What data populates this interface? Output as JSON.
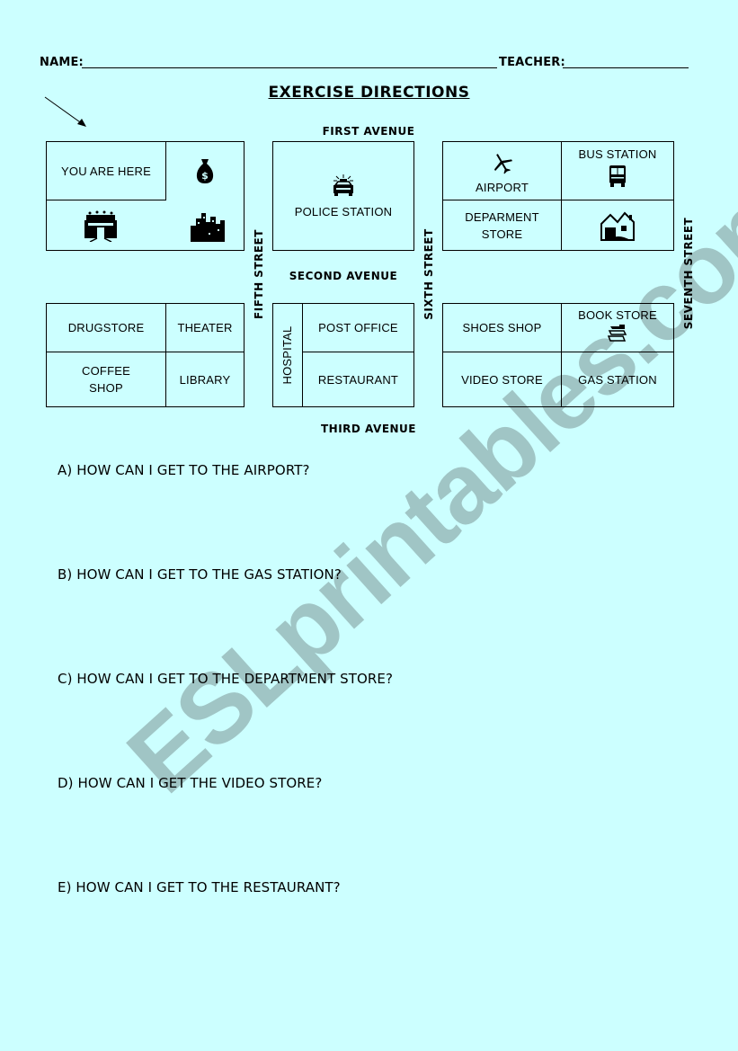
{
  "header": {
    "name_label": "NAME:",
    "teacher_label": "TEACHER:",
    "name_value": "",
    "teacher_value": ""
  },
  "title": "EXERCISE DIRECTIONS",
  "map": {
    "avenues": {
      "first": "FIRST AVENUE",
      "second": "SECOND AVENUE",
      "third": "THIRD AVENUE"
    },
    "streets": {
      "fifth": "FIFTH STREET",
      "sixth": "SIXTH STREET",
      "seventh": "SEVENTH STREET"
    },
    "start_marker": "you-are-here-arrow",
    "blocks": {
      "top_left": {
        "you_are_here": "YOU ARE HERE",
        "icons": [
          "money-bag-icon",
          "stadium-icon",
          "city-skyline-icon"
        ]
      },
      "top_middle": {
        "police_station": "POLICE STATION",
        "icon": "police-car-icon"
      },
      "top_right": {
        "airport": "AIRPORT",
        "bus_station": "BUS STATION",
        "department_store_line1": "DEPARMENT",
        "department_store_line2": "STORE",
        "icons": [
          "airplane-icon",
          "bus-icon",
          "houses-icon"
        ]
      },
      "bottom_left": {
        "drugstore": "DRUGSTORE",
        "theater": "THEATER",
        "coffee_shop_line1": "COFFEE",
        "coffee_shop_line2": "SHOP",
        "library": "LIBRARY"
      },
      "bottom_middle": {
        "hospital": "HOSPITAL",
        "post_office": "POST OFFICE",
        "restaurant": "RESTAURANT"
      },
      "bottom_right": {
        "shoes_shop": "SHOES SHOP",
        "book_store": "BOOK STORE",
        "video_store": "VIDEO STORE",
        "gas_station": "GAS STATION",
        "icon": "books-icon"
      }
    }
  },
  "questions": [
    {
      "letter": "A)",
      "text": "HOW CAN I GET TO THE AIRPORT?"
    },
    {
      "letter": "B)",
      "text": "HOW CAN I GET TO THE GAS STATION?"
    },
    {
      "letter": "C)",
      "text": "HOW CAN I GET TO THE DEPARTMENT STORE?"
    },
    {
      "letter": "D)",
      "text": "HOW CAN I GET THE VIDEO STORE?"
    },
    {
      "letter": "E)",
      "text": "HOW CAN I GET TO THE RESTAURANT?"
    }
  ],
  "watermark": "ESLprintables.com",
  "colors": {
    "background": "#ccffff",
    "watermark": "#99bcbc",
    "ink": "#000000"
  }
}
